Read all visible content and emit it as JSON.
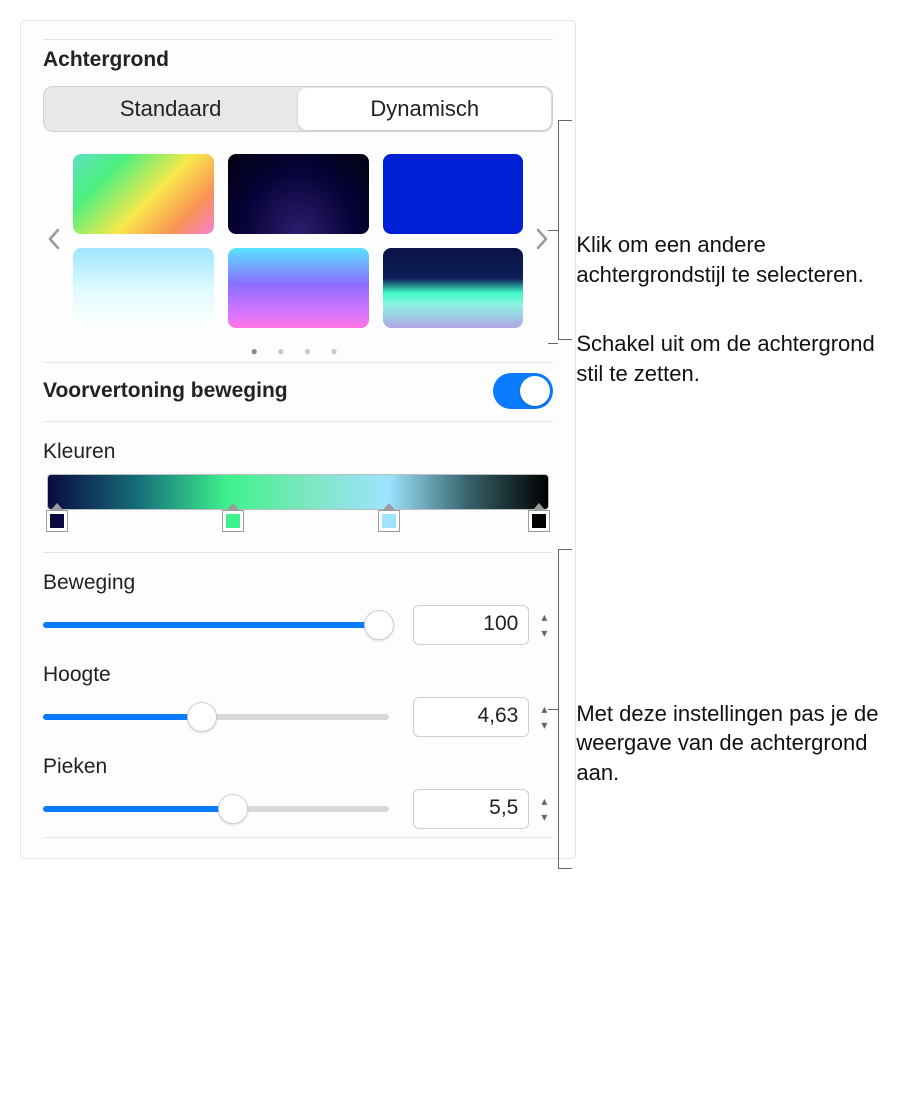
{
  "background": {
    "title": "Achtergrond",
    "tabs": {
      "standard": "Standaard",
      "dynamic": "Dynamisch"
    },
    "pages": 4,
    "active_page": 0
  },
  "preview": {
    "label": "Voorvertoning beweging",
    "on": true
  },
  "colors": {
    "label": "Kleuren",
    "stops": [
      {
        "pos": 0,
        "color": "#0a0a40"
      },
      {
        "pos": 36,
        "color": "#3df28c"
      },
      {
        "pos": 68,
        "color": "#9ee3ff"
      },
      {
        "pos": 100,
        "color": "#000000"
      }
    ]
  },
  "sliders": {
    "beweging": {
      "label": "Beweging",
      "value": "100",
      "pct": 100
    },
    "hoogte": {
      "label": "Hoogte",
      "value": "4,63",
      "pct": 46
    },
    "pieken": {
      "label": "Pieken",
      "value": "5,5",
      "pct": 55
    }
  },
  "annotations": {
    "select_style": "Klik om een andere achtergrondstijl te selecteren.",
    "toggle_motion": "Schakel uit om de achtergrond stil te zetten.",
    "adjust_look": "Met deze instellingen pas je de weergave van de achtergrond aan."
  }
}
